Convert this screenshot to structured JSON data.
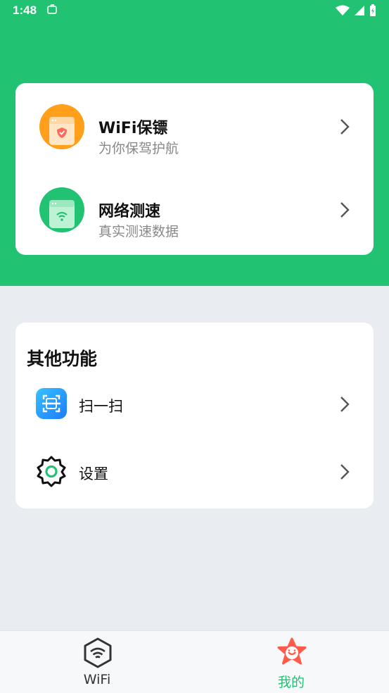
{
  "status_bar": {
    "time": "1:48"
  },
  "features": [
    {
      "title": "WiFi保镖",
      "subtitle": "为你保驾护航",
      "icon": "shield-phone-icon",
      "color": "#FF9F1A"
    },
    {
      "title": "网络测速",
      "subtitle": "真实测速数据",
      "icon": "wifi-phone-icon",
      "color": "#22C273"
    }
  ],
  "other": {
    "title": "其他功能",
    "items": [
      {
        "label": "扫一扫",
        "icon": "scan-icon"
      },
      {
        "label": "设置",
        "icon": "settings-gear-icon"
      }
    ]
  },
  "tabbar": {
    "tabs": [
      {
        "label": "WiFi",
        "icon": "wifi-tab-icon",
        "active": false
      },
      {
        "label": "我的",
        "icon": "profile-star-icon",
        "active": true
      }
    ]
  },
  "colors": {
    "brand": "#22C273",
    "orange": "#FF9F1A",
    "background": "#E9ECF0"
  }
}
